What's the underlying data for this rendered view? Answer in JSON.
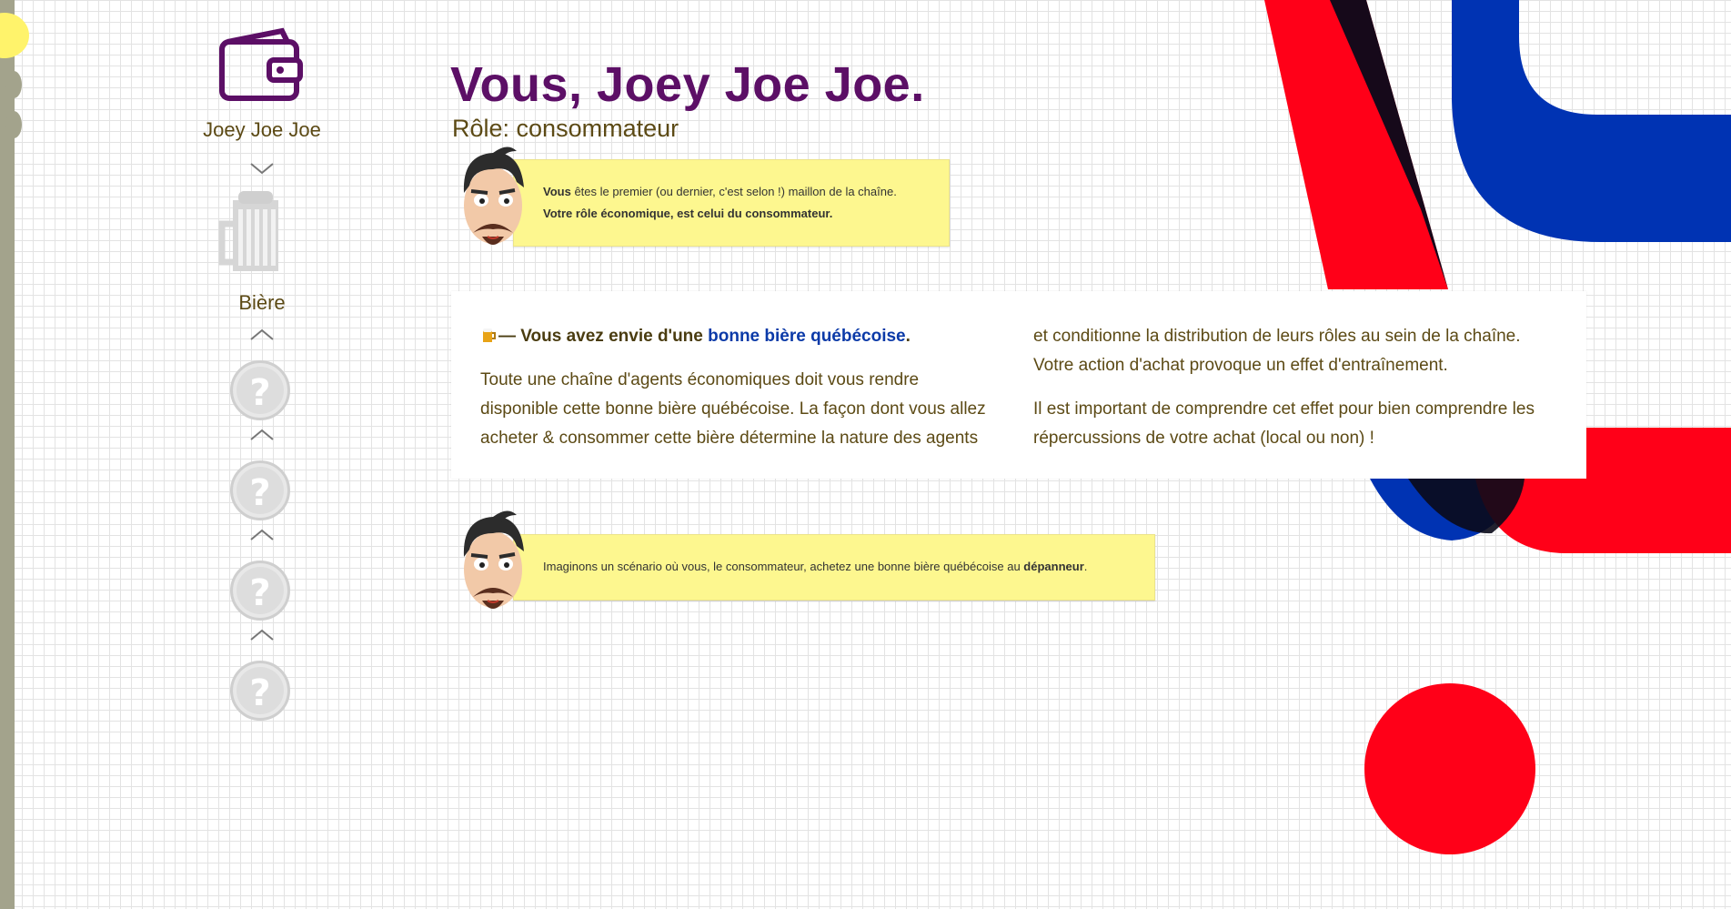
{
  "colors": {
    "title": "#5c0f66",
    "text": "#5c4a15",
    "note_bg": "#fdf78f",
    "link": "#0b3aa8",
    "accent_red": "#ff0018",
    "accent_blue": "#0033b3",
    "accent_black": "#0a0a1a"
  },
  "sidebar": {
    "profile": {
      "icon": "wallet-icon",
      "name": "Joey Joe Joe"
    },
    "product": {
      "icon": "beer-mug-icon",
      "label": "Bière"
    },
    "locked_steps": [
      {
        "icon": "question-coin-icon",
        "symbol": "?"
      },
      {
        "icon": "question-coin-icon",
        "symbol": "?"
      },
      {
        "icon": "question-coin-icon",
        "symbol": "?"
      },
      {
        "icon": "question-coin-icon",
        "symbol": "?"
      }
    ]
  },
  "header": {
    "title": "Vous, Joey Joe Joe.",
    "role": "Rôle: consommateur"
  },
  "note1": {
    "avatar_icon": "bearded-man-avatar-icon",
    "line1_bold": "Vous",
    "line1_rest": " êtes le premier (ou dernier, c'est selon !) maillon de la chaîne.",
    "line2": "Votre rôle économique, est celui du consommateur."
  },
  "intro": {
    "emoji": "beer-emoji",
    "lead_prefix": "— Vous avez envie d'une ",
    "lead_link": "bonne bière québécoise",
    "lead_suffix": ".",
    "col1_para": "Toute une chaîne d'agents économiques doit vous rendre disponible cette bonne bière québécoise. La façon dont vous allez acheter & consommer cette bière détermine la nature des agents",
    "col2_para1": "et conditionne la distribution de leurs rôles au sein de la chaîne. Votre action d'achat provoque un effet d'entraînement.",
    "col2_para2": "Il est important de comprendre cet effet pour bien comprendre les répercussions de votre achat (local ou non) !"
  },
  "note2": {
    "avatar_icon": "bearded-man-avatar-icon",
    "text": "Imaginons un scénario où vous, le consommateur, achetez une bonne bière québécoise au ",
    "bold": "dépanneur",
    "end": "."
  }
}
